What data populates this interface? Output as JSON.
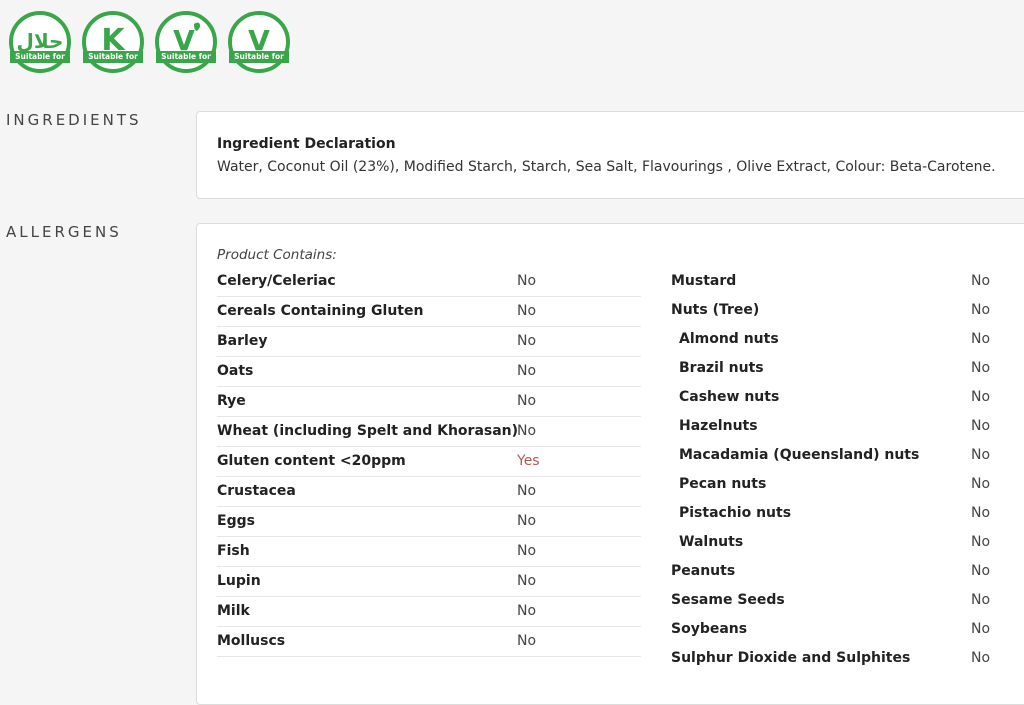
{
  "badges": [
    {
      "icon": "halal-icon",
      "glyph": "حلال",
      "label": "Suitable for"
    },
    {
      "icon": "kosher-icon",
      "glyph": "K",
      "label": "Suitable for"
    },
    {
      "icon": "vegetarian-icon",
      "glyph": "V",
      "label": "Suitable for"
    },
    {
      "icon": "vegan-icon",
      "glyph": "V",
      "label": "Suitable for"
    }
  ],
  "ingredients": {
    "heading": "INGREDIENTS",
    "title": "Ingredient Declaration",
    "text": "Water, Coconut Oil (23%), Modified Starch, Starch, Sea Salt, Flavourings , Olive Extract, Colour: Beta-Carotene."
  },
  "allergens": {
    "heading": "ALLERGENS",
    "contains_label": "Product Contains:",
    "left": [
      {
        "name": "Celery/Celeriac",
        "value": "No"
      },
      {
        "name": "Cereals Containing Gluten",
        "value": "No"
      },
      {
        "name": "Barley",
        "value": "No"
      },
      {
        "name": "Oats",
        "value": "No"
      },
      {
        "name": "Rye",
        "value": "No"
      },
      {
        "name": "Wheat (including Spelt and Khorasan)",
        "value": "No"
      },
      {
        "name": "Gluten content <20ppm",
        "value": "Yes"
      },
      {
        "name": "Crustacea",
        "value": "No"
      },
      {
        "name": "Eggs",
        "value": "No"
      },
      {
        "name": "Fish",
        "value": "No"
      },
      {
        "name": "Lupin",
        "value": "No"
      },
      {
        "name": "Milk",
        "value": "No"
      },
      {
        "name": "Molluscs",
        "value": "No"
      }
    ],
    "right": [
      {
        "name": "Mustard",
        "value": "No"
      },
      {
        "name": "Nuts (Tree)",
        "value": "No"
      },
      {
        "name": "Almond nuts",
        "value": "No"
      },
      {
        "name": "Brazil nuts",
        "value": "No"
      },
      {
        "name": "Cashew nuts",
        "value": "No"
      },
      {
        "name": "Hazelnuts",
        "value": "No"
      },
      {
        "name": "Macadamia (Queensland) nuts",
        "value": "No"
      },
      {
        "name": "Pecan nuts",
        "value": "No"
      },
      {
        "name": "Pistachio nuts",
        "value": "No"
      },
      {
        "name": "Walnuts",
        "value": "No"
      },
      {
        "name": "Peanuts",
        "value": "No"
      },
      {
        "name": "Sesame Seeds",
        "value": "No"
      },
      {
        "name": "Soybeans",
        "value": "No"
      },
      {
        "name": "Sulphur Dioxide and Sulphites",
        "value": "No"
      }
    ]
  },
  "colors": {
    "badge_green": "#3aa64a",
    "yes_value": "#b35a55"
  }
}
